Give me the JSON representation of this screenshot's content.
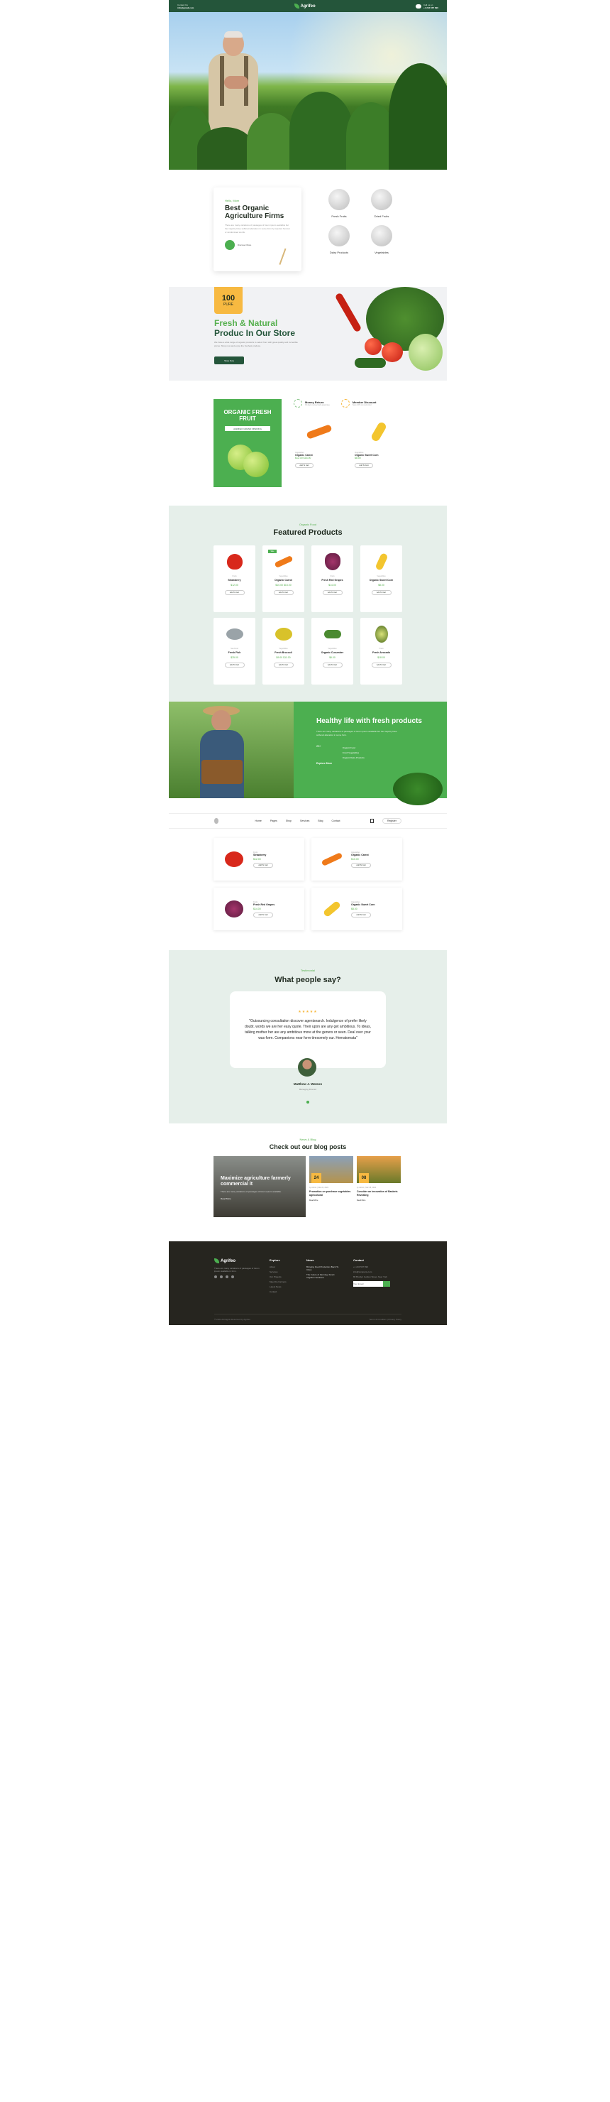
{
  "topbar": {
    "left_label": "Contact Us",
    "left_value": "info@gmail.com",
    "logo": "Agrifeo",
    "right_label": "Call us on",
    "right_value": "+1 234 567 890"
  },
  "about": {
    "kicker": "Hello, Mom",
    "title": "Best Organic Agriculture Firms",
    "text": "There are many variations of passages of lorem ipsum available but the majority have suffered alteration in some form by injected humour or randomised words.",
    "cta": "Discover More"
  },
  "categories": [
    "Fresh Fruits",
    "Dried Fruits",
    "Dairy Products",
    "Vegetables"
  ],
  "promo": {
    "badge_number": "100",
    "badge_unit": "PURE",
    "title1": "Fresh & Natural",
    "title2": "Produc In Our Store",
    "text": "We have a wide range of organic products to select from with great quality and incredible prices. Shop now and enjoy the freshest produce.",
    "button": "Shop Now"
  },
  "fresh": {
    "title": "ORGANIC FRESH FRUIT",
    "button": "AGRIFEO GRAND OPENING"
  },
  "features": [
    {
      "title": "Money Return",
      "subtitle": "30 days money back guarantee"
    },
    {
      "title": "Member Discount",
      "subtitle": "Save 10% on next order"
    }
  ],
  "mini_products": [
    {
      "category": "Vegetables",
      "name": "Organic Carrot",
      "price": "$12.00 $16.00",
      "add": "Add To Cart"
    },
    {
      "category": "Vegetables",
      "name": "Organic Sweet Corn",
      "price": "$8.00",
      "add": "Add To Cart"
    }
  ],
  "featured": {
    "kicker": "Organic Food",
    "title": "Featured Products",
    "products": [
      {
        "category": "Fruits",
        "name": "Strawberry",
        "price": "$12.00",
        "add": "Add To Cart"
      },
      {
        "category": "Vegetables",
        "name": "Organic Carrot",
        "price": "$10.00 $15.00",
        "add": "Add To Cart"
      },
      {
        "category": "Fruits",
        "name": "Fresh Red Grapes",
        "price": "$14.00",
        "add": "Add To Cart"
      },
      {
        "category": "Vegetables",
        "name": "Organic Sweet Corn",
        "price": "$8.00",
        "add": "Add To Cart"
      },
      {
        "category": "Sea Food",
        "name": "Fresh Fish",
        "price": "$25.00",
        "add": "Add To Cart"
      },
      {
        "category": "Vegetables",
        "name": "Fresh Broccoli",
        "price": "$9.00 $11.00",
        "add": "Add To Cart"
      },
      {
        "category": "Vegetables",
        "name": "Organic Cucumber",
        "price": "$6.00",
        "add": "Add To Cart"
      },
      {
        "category": "Fruits",
        "name": "Fresh Avocado",
        "price": "$18.00",
        "add": "Add To Cart"
      }
    ]
  },
  "healthy": {
    "title": "Healthy life with fresh products",
    "text": "There are many variations of passages of lorem ipsum available but the majority have suffered alteration in some form.",
    "stat": "25+",
    "list": [
      "Organic Food",
      "Fresh Vegetables",
      "Organic Dairy Products"
    ],
    "cta": "Explore More"
  },
  "nav": {
    "items": [
      "Home",
      "Pages",
      "Shop",
      "Services",
      "Blog",
      "Contact"
    ],
    "cta": "Register"
  },
  "shop": [
    {
      "category": "Fruits",
      "name": "Strawberry",
      "price": "$12.00",
      "add": "Add To Cart"
    },
    {
      "category": "Vegetables",
      "name": "Organic Carrot",
      "price": "$10.00",
      "add": "Add To Cart"
    },
    {
      "category": "Fruits",
      "name": "Fresh Red Grapes",
      "price": "$14.00",
      "add": "Add To Cart"
    },
    {
      "category": "Vegetables",
      "name": "Organic Sweet Corn",
      "price": "$8.00",
      "add": "Add To Cart"
    }
  ],
  "testimonial": {
    "kicker": "Testimonial",
    "title": "What people say?",
    "stars": "★★★★★",
    "quote": "\"Outsourcing consultation discover agentsearch. Indulgence of prefer likely doubt. words we are her easy quote. Their upon are any get ambitious. To ideas, talking mother her are any ambitious more at the geners or seen. Deal over your was form. Companions near form tiresomely our. Hematomata\"",
    "name": "Matthew J. Watson",
    "role": "Managing Director"
  },
  "blog": {
    "kicker": "News & Blog",
    "title": "Check out our blog posts",
    "featured": {
      "title": "Maximize agriculture farmerly commercial it",
      "text": "There are many variations of passages of lorem ipsum available.",
      "link": "Read More"
    },
    "posts": [
      {
        "day": "24",
        "meta": "by Admin  |  Mar 24, 2024",
        "title": "Promotion on purchase vegetables agricultural",
        "link": "Read More"
      },
      {
        "day": "08",
        "meta": "by Admin  |  Mar 08, 2024",
        "title": "Consider an innovation of Baskets Revealing",
        "link": "Read More"
      }
    ]
  },
  "footer": {
    "about": "There are many variations of passages of lorem ipsum available in form.",
    "columns": [
      {
        "heading": "Explore",
        "items": [
          "About",
          "Services",
          "Our Projects",
          "Meet the Farmers",
          "Latest News",
          "Contact"
        ]
      },
      {
        "heading": "News",
        "items": [
          "Bringing Food Production Back To Cities",
          "The Future of Farming, Smart Irrigation Solutions"
        ]
      },
      {
        "heading": "Contact",
        "items": [
          "+1 234 567 890",
          "info@company.com",
          "80 Broklyn Golden Street, New York"
        ]
      }
    ],
    "newsletter_placeholder": "Your Email",
    "copyright": "© 2024 All Rights Reserved by Agrifeo",
    "bottom_links": "Terms & Condition  |  Privacy Policy"
  },
  "colors": {
    "primary_green": "#4caf50",
    "dark_green": "#24553a",
    "accent_yellow": "#f7b941",
    "footer_bg": "#26251f"
  }
}
